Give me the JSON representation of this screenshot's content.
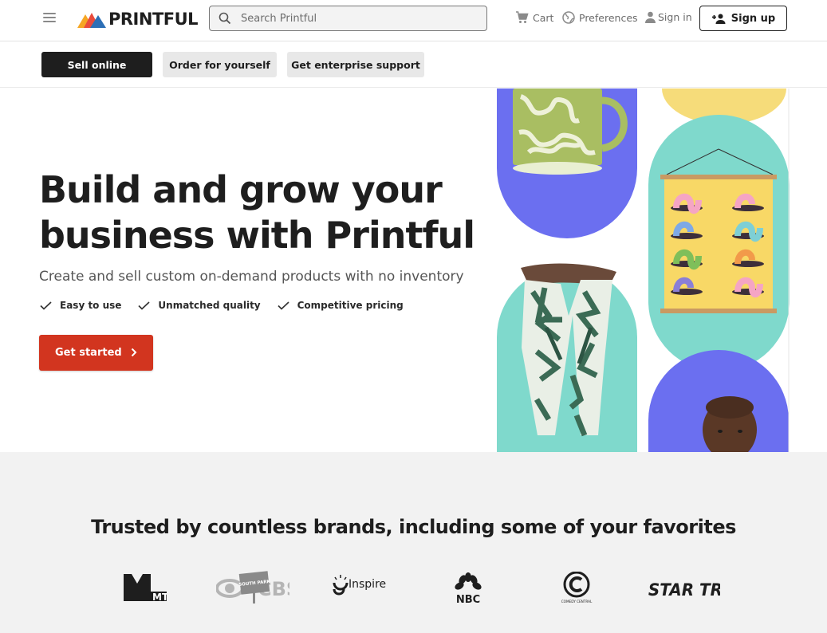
{
  "header": {
    "logo_text": "PRINTFUL",
    "search_placeholder": "Search Printful",
    "cart_label": "Cart",
    "preferences_label": "Preferences",
    "signin_label": "Sign in",
    "signup_label": "Sign up"
  },
  "subnav": {
    "items": [
      "Sell online",
      "Order for yourself",
      "Get enterprise support"
    ],
    "active": "Sell online"
  },
  "hero": {
    "title_line1": "Build and grow your",
    "title_line2": "business with Printful",
    "subtitle": "Create and sell custom on-demand products with no inventory",
    "features": [
      "Easy to use",
      "Unmatched quality",
      "Competitive pricing"
    ],
    "cta_label": "Get started"
  },
  "brands": {
    "title": "Trusted by countless brands, including some of your favorites",
    "logos": [
      "MTV",
      "CBS",
      "SOUTH PARK",
      "Inspire Uplift",
      "NBC",
      "COMEDY CENTRAL",
      "STAR TREK"
    ]
  },
  "colors": {
    "accent": "#d2351f",
    "dark": "#1e1e1e",
    "blob_blue": "#6b6ff0",
    "blob_teal": "#7fd9cc",
    "blob_yellow": "#f6dc7a"
  }
}
